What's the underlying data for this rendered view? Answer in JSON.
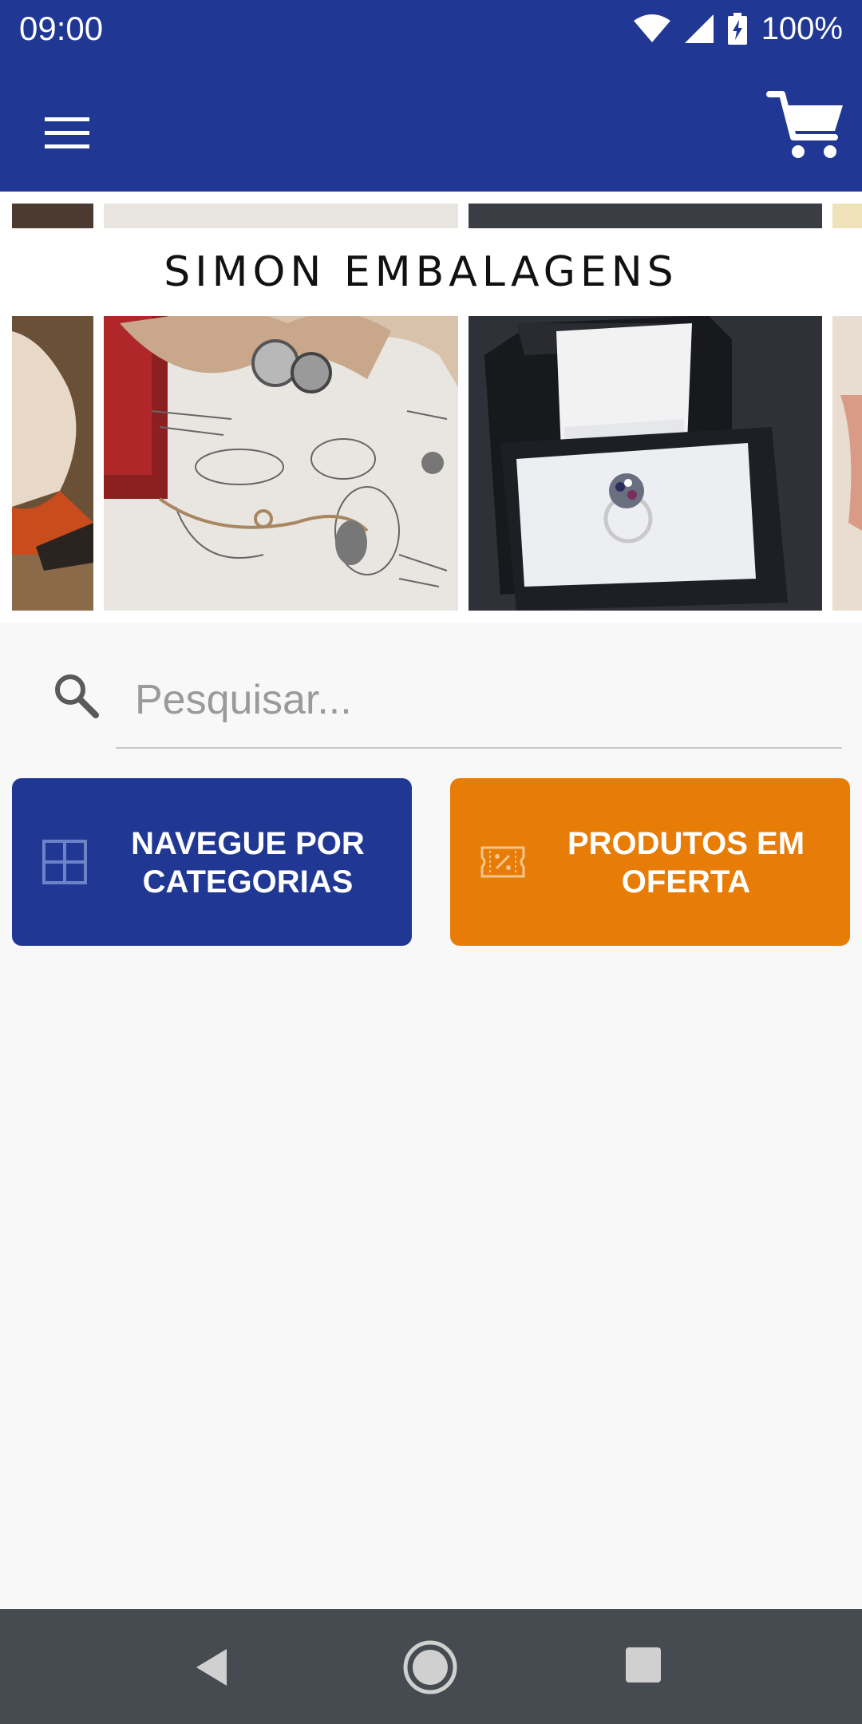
{
  "status_bar": {
    "time": "09:00",
    "battery": "100%",
    "icons": [
      "wifi-icon",
      "signal-icon",
      "battery-charging-icon"
    ]
  },
  "app_bar": {
    "menu_icon": "hamburger-menu-icon",
    "cart_icon": "shopping-cart-icon",
    "color": "#203893"
  },
  "carousel": {
    "banner_text": "SIMON EMBALAGENS",
    "slides": [
      "jeweler-hands-slide",
      "sketches-ring-loupe-slide",
      "ring-box-slide",
      "edge-slide"
    ]
  },
  "search": {
    "placeholder": "Pesquisar...",
    "value": "",
    "icon": "search-icon"
  },
  "actions": {
    "categories": {
      "label": "NAVEGUE POR CATEGORIAS",
      "icon": "grid-icon",
      "color": "#203893"
    },
    "offers": {
      "label": "PRODUTOS EM OFERTA",
      "icon": "discount-ticket-icon",
      "color": "#e77c06"
    }
  },
  "nav_bar": {
    "back_icon": "back-triangle-icon",
    "home_icon": "home-circle-icon",
    "recent_icon": "recent-apps-square-icon"
  }
}
